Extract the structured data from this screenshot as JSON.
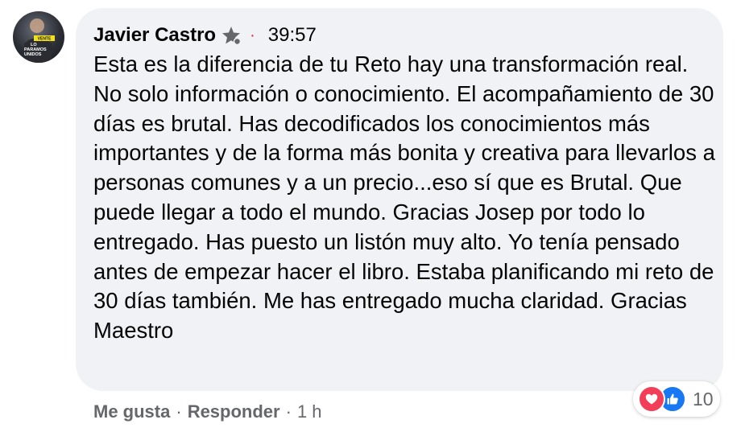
{
  "comment": {
    "author": "Javier Castro",
    "separator": "·",
    "timestamp": "39:57",
    "text": "Esta es la diferencia de tu Reto hay una transformación real. No solo información o conocimiento. El acompañamiento de 30 días es brutal. Has decodificados los conocimientos más importantes y de la forma más bonita y creativa para llevarlos a personas comunes y a un precio...eso sí que es Brutal. Que puede llegar a todo el mundo. Gracias Josep por todo lo entregado. Has puesto un listón muy alto. Yo tenía pensado antes de empezar hacer el libro. Estaba planificando mi reto de 30 días también. Me has entregado mucha claridad. Gracias Maestro",
    "avatar_text": [
      "VENTE",
      "LO",
      "PARAMOS",
      "UNIDOS"
    ]
  },
  "actions": {
    "like_label": "Me gusta",
    "reply_label": "Responder",
    "dot": "·",
    "ago": "1 h"
  },
  "reactions": {
    "icons": [
      "love-icon",
      "like-icon"
    ],
    "count": "10"
  },
  "colors": {
    "bubble": "#f0f2f5",
    "secondary_text": "#65676b",
    "love": "#f33e58",
    "like": "#1877f2",
    "dot": "#e41e3f"
  }
}
